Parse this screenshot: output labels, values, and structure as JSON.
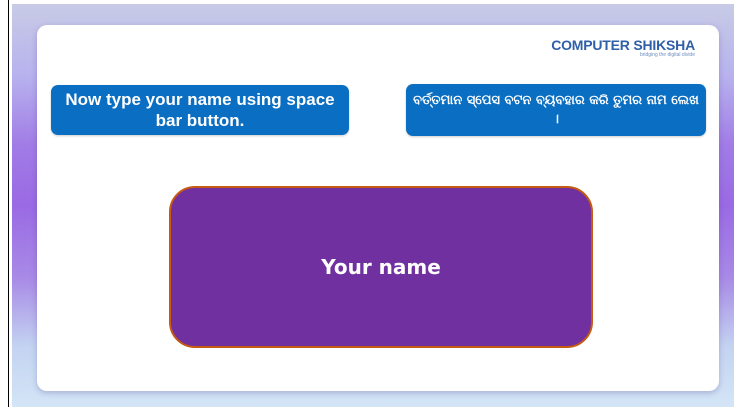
{
  "logo": {
    "main": "COMPUTER SHIKSHA",
    "tagline": "bridging the digital divide"
  },
  "instructions": {
    "english": "Now type your name using space bar button.",
    "odia": "ବର୍ତ୍ତମାନ ସ୍ପେସ ବଟନ ବ୍ୟବହାର କରି ତୁମର ନାମ ଲେଖ ।"
  },
  "name_box": {
    "text": "Your name"
  },
  "colors": {
    "callout": "#0a6fc2",
    "name_box_fill": "#7030a0",
    "name_box_border": "#c55a11"
  }
}
